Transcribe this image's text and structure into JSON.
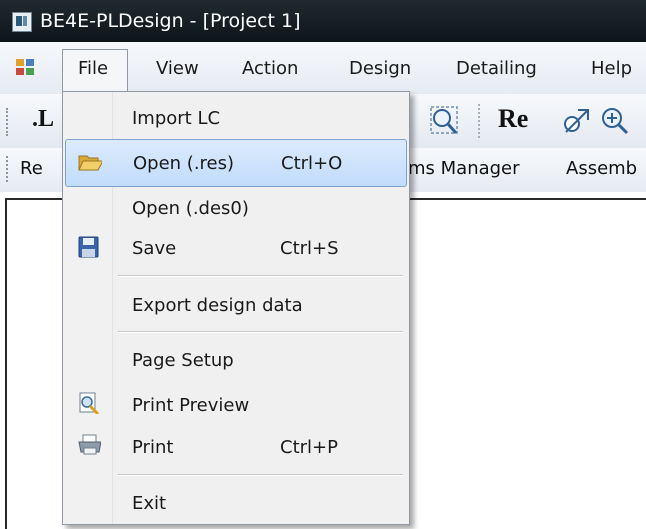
{
  "window": {
    "title": "BE4E-PLDesign - [Project 1]"
  },
  "menubar": {
    "items": [
      "File",
      "View",
      "Action",
      "Design",
      "Detailing",
      "Help"
    ]
  },
  "toolbar1": {
    "left_text": ".L",
    "right_text": "Re"
  },
  "toolbar2": {
    "left_text": "Re",
    "items_manager": "ms Manager",
    "assembly": "Assemb"
  },
  "file_menu": {
    "items": [
      {
        "label": "Import LC",
        "shortcut": "",
        "icon": ""
      },
      {
        "label": "Open (.res)",
        "shortcut": "Ctrl+O",
        "icon": "open-folder-icon",
        "highlighted": true
      },
      {
        "label": "Open (.des0)",
        "shortcut": "",
        "icon": ""
      },
      {
        "label": "Save",
        "shortcut": "Ctrl+S",
        "icon": "floppy-disk-icon"
      },
      {
        "label": "Export design data",
        "shortcut": "",
        "icon": ""
      },
      {
        "label": "Page Setup",
        "shortcut": "",
        "icon": ""
      },
      {
        "label": "Print Preview",
        "shortcut": "",
        "icon": "print-preview-icon"
      },
      {
        "label": "Print",
        "shortcut": "Ctrl+P",
        "icon": "printer-icon"
      },
      {
        "label": "Exit",
        "shortcut": "",
        "icon": ""
      }
    ]
  },
  "colors": {
    "titlebar": "#16212a",
    "highlight": "#cfe4fc",
    "highlight_border": "#7da2ce",
    "menu_background": "#f0f0f0"
  }
}
